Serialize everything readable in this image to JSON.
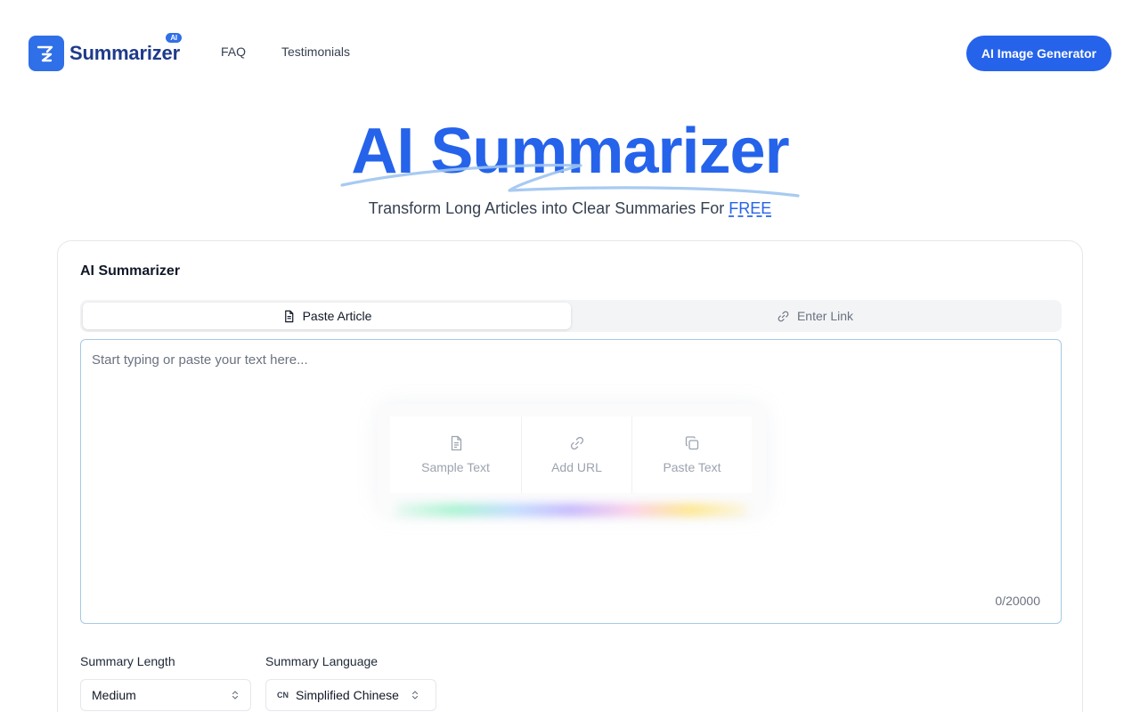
{
  "header": {
    "logo_text": "Summarizer",
    "logo_badge": "AI",
    "nav": [
      {
        "label": "FAQ"
      },
      {
        "label": "Testimonials"
      }
    ],
    "cta_label": "AI Image Generator"
  },
  "hero": {
    "title": "AI Summarizer",
    "subtitle": "Transform Long Articles into Clear Summaries For ",
    "subtitle_emphasis": "FREE"
  },
  "card": {
    "title": "AI Summarizer",
    "tabs": [
      {
        "label": "Paste Article",
        "icon": "document-icon",
        "active": true
      },
      {
        "label": "Enter Link",
        "icon": "link-icon",
        "active": false
      }
    ],
    "editor": {
      "placeholder": "Start typing or paste your text here...",
      "value": "",
      "counter": "0/20000"
    },
    "quick_actions": [
      {
        "label": "Sample Text",
        "icon": "file-text-icon"
      },
      {
        "label": "Add URL",
        "icon": "link-icon"
      },
      {
        "label": "Paste Text",
        "icon": "copy-icon"
      }
    ],
    "options": {
      "length_label": "Summary Length",
      "length_value": "Medium",
      "language_label": "Summary Language",
      "language_flag": "CN",
      "language_value": "Simplified Chinese"
    }
  },
  "colors": {
    "accent": "#2563eb",
    "logo_bg": "#2f6fe8",
    "editor_border": "#a5c8e4"
  }
}
